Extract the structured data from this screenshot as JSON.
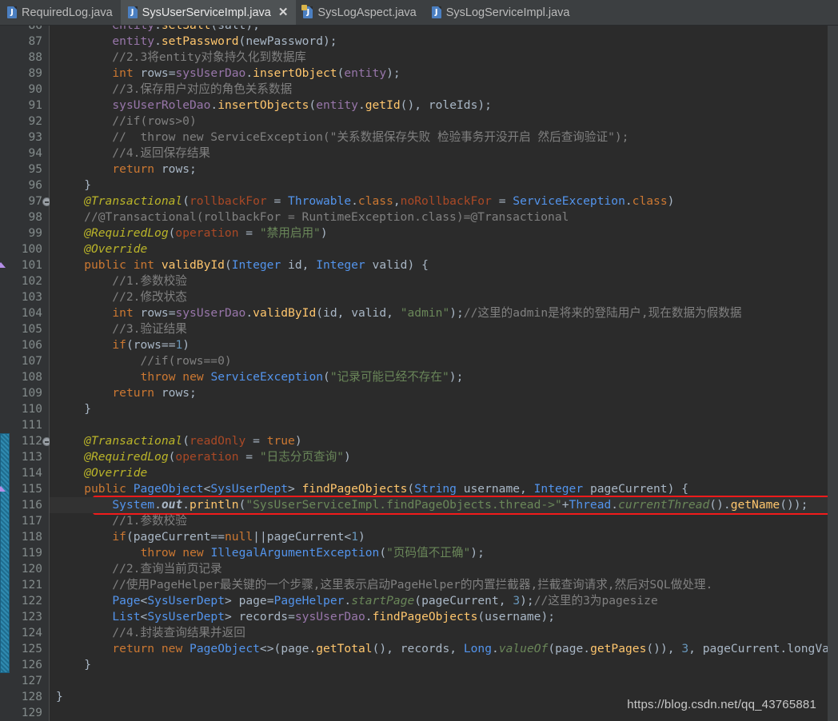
{
  "window": {
    "app": "IntelliJ IDEA Editor",
    "watermark": "https://blog.csdn.net/qq_43765881"
  },
  "tabs": [
    {
      "label": "RequiredLog.java",
      "icon": "java-file-icon",
      "active": false,
      "closable": false
    },
    {
      "label": "SysUserServiceImpl.java",
      "icon": "java-file-icon",
      "active": true,
      "closable": true,
      "close_label": "✕"
    },
    {
      "label": "SysLogAspect.java",
      "icon": "java-file-locked-icon",
      "active": false,
      "closable": false
    },
    {
      "label": "SysLogServiceImpl.java",
      "icon": "java-file-icon",
      "active": false,
      "closable": false
    }
  ],
  "editor": {
    "first_visible_line": 86,
    "caret_line": 116,
    "change_bar": {
      "from_line": 112,
      "to_line": 126,
      "color": "#2f8ab0"
    },
    "highlight_box": {
      "line": 116,
      "color": "#f21b1b"
    },
    "gutter_markers": [
      {
        "line": 97,
        "glyph": "fold-collapse-icon"
      },
      {
        "line": 101,
        "glyph": "override-method-icon"
      },
      {
        "line": 112,
        "glyph": "fold-collapse-icon"
      },
      {
        "line": 115,
        "glyph": "override-method-icon"
      }
    ],
    "lines": [
      {
        "n": 86,
        "text": "        entity.setSalt(salt);"
      },
      {
        "n": 87,
        "text": "        entity.setPassword(newPassword);"
      },
      {
        "n": 88,
        "text": "        //2.3将entity对象持久化到数据库"
      },
      {
        "n": 89,
        "text": "        int rows=sysUserDao.insertObject(entity);"
      },
      {
        "n": 90,
        "text": "        //3.保存用户对应的角色关系数据"
      },
      {
        "n": 91,
        "text": "        sysUserRoleDao.insertObjects(entity.getId(), roleIds);"
      },
      {
        "n": 92,
        "text": "        //if(rows>0)"
      },
      {
        "n": 93,
        "text": "        //  throw new ServiceException(\"关系数据保存失败 检验事务开没开启 然后查询验证\");"
      },
      {
        "n": 94,
        "text": "        //4.返回保存结果"
      },
      {
        "n": 95,
        "text": "        return rows;"
      },
      {
        "n": 96,
        "text": "    }"
      },
      {
        "n": 97,
        "text": "    @Transactional(rollbackFor = Throwable.class,noRollbackFor = ServiceException.class)"
      },
      {
        "n": 98,
        "text": "    //@Transactional(rollbackFor = RuntimeException.class)=@Transactional"
      },
      {
        "n": 99,
        "text": "    @RequiredLog(operation = \"禁用启用\")"
      },
      {
        "n": 100,
        "text": "    @Override"
      },
      {
        "n": 101,
        "text": "    public int validById(Integer id, Integer valid) {"
      },
      {
        "n": 102,
        "text": "        //1.参数校验"
      },
      {
        "n": 103,
        "text": "        //2.修改状态"
      },
      {
        "n": 104,
        "text": "        int rows=sysUserDao.validById(id, valid, \"admin\");//这里的admin是将来的登陆用户,现在数据为假数据"
      },
      {
        "n": 105,
        "text": "        //3.验证结果"
      },
      {
        "n": 106,
        "text": "        if(rows==1)"
      },
      {
        "n": 107,
        "text": "            //if(rows==0)"
      },
      {
        "n": 108,
        "text": "            throw new ServiceException(\"记录可能已经不存在\");"
      },
      {
        "n": 109,
        "text": "        return rows;"
      },
      {
        "n": 110,
        "text": "    }"
      },
      {
        "n": 111,
        "text": ""
      },
      {
        "n": 112,
        "text": "    @Transactional(readOnly = true)"
      },
      {
        "n": 113,
        "text": "    @RequiredLog(operation = \"日志分页查询\")"
      },
      {
        "n": 114,
        "text": "    @Override"
      },
      {
        "n": 115,
        "text": "    public PageObject<SysUserDept> findPageObjects(String username, Integer pageCurrent) {"
      },
      {
        "n": 116,
        "text": "        System.out.println(\"SysUserServiceImpl.findPageObjects.thread->\"+Thread.currentThread().getName());"
      },
      {
        "n": 117,
        "text": "        //1.参数校验"
      },
      {
        "n": 118,
        "text": "        if(pageCurrent==null||pageCurrent<1)"
      },
      {
        "n": 119,
        "text": "            throw new IllegalArgumentException(\"页码值不正确\");"
      },
      {
        "n": 120,
        "text": "        //2.查询当前页记录"
      },
      {
        "n": 121,
        "text": "        //使用PageHelper最关键的一个步骤,这里表示启动PageHelper的内置拦截器,拦截查询请求,然后对SQL做处理."
      },
      {
        "n": 122,
        "text": "        Page<SysUserDept> page=PageHelper.startPage(pageCurrent, 3);//这里的3为pagesize"
      },
      {
        "n": 123,
        "text": "        List<SysUserDept> records=sysUserDao.findPageObjects(username);"
      },
      {
        "n": 124,
        "text": "        //4.封装查询结果并返回"
      },
      {
        "n": 125,
        "text": "        return new PageObject<>(page.getTotal(), records, Long.valueOf(page.getPages()), 3, pageCurrent.longValu"
      },
      {
        "n": 126,
        "text": "    }"
      },
      {
        "n": 127,
        "text": ""
      },
      {
        "n": 128,
        "text": "}"
      },
      {
        "n": 129,
        "text": ""
      }
    ]
  },
  "colors": {
    "background": "#2b2b2b",
    "gutter": "#313335",
    "tabbar": "#3c3f41",
    "active_tab": "#4e5254",
    "keyword": "#cc7832",
    "string": "#6a8759",
    "comment": "#808080",
    "number": "#6897bb",
    "annotation": "#bbb529",
    "class": "#5394ec",
    "method": "#ffc66d",
    "field": "#9876aa",
    "parameter": "#aa4926",
    "highlight": "#f21b1b"
  }
}
